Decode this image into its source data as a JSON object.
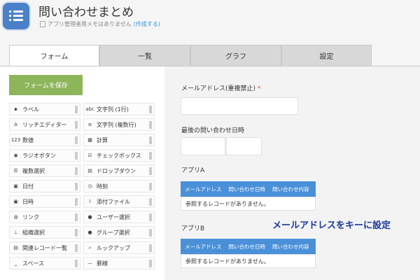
{
  "header": {
    "title": "問い合わせまとめ",
    "memo_text": "アプリ管理者用メモはありません",
    "memo_link": "(作成する)"
  },
  "tabs": [
    {
      "label": "フォーム",
      "active": true
    },
    {
      "label": "一覧",
      "active": false
    },
    {
      "label": "グラフ",
      "active": false
    },
    {
      "label": "設定",
      "active": false
    }
  ],
  "palette": {
    "save_label": "フォームを保存",
    "items": [
      {
        "label": "ラベル",
        "icon": "tag-icon",
        "glyph": "⬥"
      },
      {
        "label": "文字列 (1行)",
        "icon": "text-single-line-icon",
        "glyph": "abc"
      },
      {
        "label": "リッチエディター",
        "icon": "rich-editor-icon",
        "glyph": "A"
      },
      {
        "label": "文字列 (複数行)",
        "icon": "text-multi-line-icon",
        "glyph": "≡"
      },
      {
        "label": "数値",
        "icon": "number-icon",
        "glyph": "123"
      },
      {
        "label": "計算",
        "icon": "calculator-icon",
        "glyph": "▦"
      },
      {
        "label": "ラジオボタン",
        "icon": "radio-button-icon",
        "glyph": "◉"
      },
      {
        "label": "チェックボックス",
        "icon": "checkbox-icon",
        "glyph": "☑"
      },
      {
        "label": "複数選択",
        "icon": "multi-select-icon",
        "glyph": "☰"
      },
      {
        "label": "ドロップダウン",
        "icon": "dropdown-icon",
        "glyph": "▤"
      },
      {
        "label": "日付",
        "icon": "calendar-icon",
        "glyph": "▣"
      },
      {
        "label": "時刻",
        "icon": "clock-icon",
        "glyph": "◷"
      },
      {
        "label": "日時",
        "icon": "datetime-icon",
        "glyph": "▣"
      },
      {
        "label": "添付ファイル",
        "icon": "paperclip-icon",
        "glyph": "⌇"
      },
      {
        "label": "リンク",
        "icon": "globe-icon",
        "glyph": "◍"
      },
      {
        "label": "ユーザー選択",
        "icon": "user-icon",
        "glyph": "●"
      },
      {
        "label": "組織選択",
        "icon": "organization-icon",
        "glyph": "⊥"
      },
      {
        "label": "グループ選択",
        "icon": "group-icon",
        "glyph": "●"
      },
      {
        "label": "関連レコード一覧",
        "icon": "related-records-icon",
        "glyph": "▤"
      },
      {
        "label": "ルックアップ",
        "icon": "lookup-icon",
        "glyph": "⌕"
      },
      {
        "label": "スペース",
        "icon": "space-icon",
        "glyph": "⎵"
      },
      {
        "label": "罫線",
        "icon": "line-icon",
        "glyph": "—"
      }
    ]
  },
  "canvas": {
    "email_label": "メールアドレス(重複禁止)",
    "required_mark": "*",
    "last_inquiry_label": "最後の問い合わせ日時",
    "app_a": {
      "title": "アプリA",
      "columns": [
        "メールアドレス",
        "問い合わせ日時",
        "問い合わせ内容"
      ],
      "empty_text": "参照するレコードがありません。"
    },
    "app_b": {
      "title": "アプリB",
      "columns": [
        "メールアドレス",
        "問い合わせ日時",
        "問い合わせ内容"
      ],
      "empty_text": "参照するレコードがありません。"
    }
  },
  "annotation": "メールアドレスをキーに設定",
  "colors": {
    "accent": "#4a90d9",
    "save_button": "#8db55a",
    "required": "#e74c3c",
    "annotation": "#1a3a9c"
  }
}
